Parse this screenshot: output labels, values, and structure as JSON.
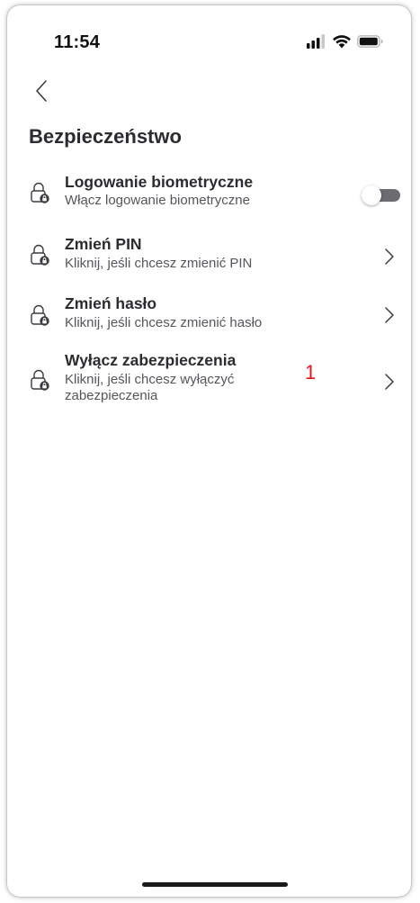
{
  "status_bar": {
    "time": "11:54",
    "icons": [
      "cellular-signal-icon",
      "wifi-icon",
      "battery-icon"
    ]
  },
  "header": {
    "back_icon": "chevron-left-icon",
    "title": "Bezpieczeństwo"
  },
  "items": [
    {
      "title": "Logowanie biometryczne",
      "subtitle": "Włącz logowanie biometryczne",
      "icon": "lock-icon",
      "control": "toggle",
      "toggle_on": false
    },
    {
      "title": "Zmień PIN",
      "subtitle": "Kliknij, jeśli chcesz zmienić PIN",
      "icon": "lock-icon",
      "control": "chevron-right-icon"
    },
    {
      "title": "Zmień hasło",
      "subtitle": "Kliknij, jeśli chcesz zmienić hasło",
      "icon": "lock-icon",
      "control": "chevron-right-icon"
    },
    {
      "title": "Wyłącz zabezpieczenia",
      "subtitle": "Kliknij, jeśli chcesz wyłączyć zabezpieczenia",
      "icon": "lock-icon",
      "control": "chevron-right-icon"
    }
  ],
  "annotation_marker": "1",
  "colors": {
    "text_primary": "#2b2b30",
    "text_secondary": "#55555c",
    "toggle_track": "#6b6b70",
    "marker": "#e8141e"
  }
}
